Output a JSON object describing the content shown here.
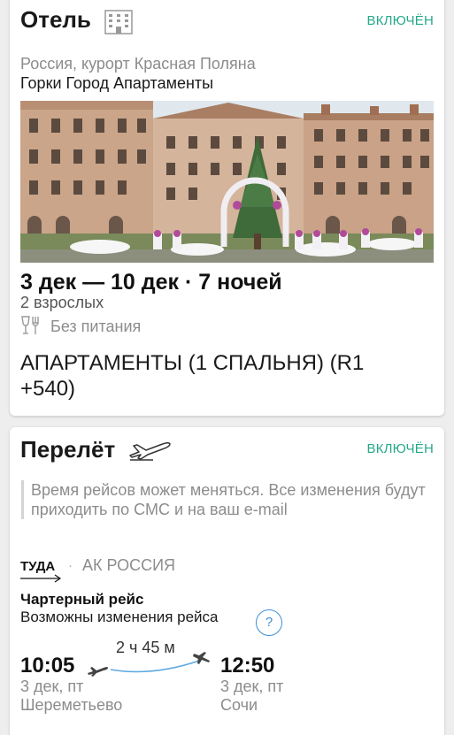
{
  "colors": {
    "accent_green": "#26a98b",
    "link_blue": "#3d8fd6",
    "muted_text": "#8c8c8c"
  },
  "hotel": {
    "title": "Отель",
    "icon": "building-icon",
    "status": "ВКЛЮЧЁН",
    "location": "Россия, курорт Красная Поляна",
    "name": "Горки Город Апартаменты",
    "dates": "3 дек — 10 дек · 7 ночей",
    "guests": "2 взрослых",
    "meal_icon": "glass-fork-icon",
    "meal": "Без питания",
    "room": "АПАРТАМЕНТЫ (1 СПАЛЬНЯ) (R1 +540)"
  },
  "flight": {
    "title": "Перелёт",
    "icon": "airplane-icon",
    "status": "ВКЛЮЧЁН",
    "notice": "Время рейсов может меняться. Все изменения будут приходить по СМС и на ваш e-mail",
    "direction": "ТУДА",
    "separator": "·",
    "airline": "АК РОССИЯ",
    "type": "Чартерный рейс",
    "change_note": "Возможны изменения рейса",
    "help": "?",
    "duration": "2 ч 45 м",
    "departure": {
      "time": "10:05",
      "date": "3 дек, пт",
      "airport": "Шереметьево"
    },
    "arrival": {
      "time": "12:50",
      "date": "3 дек, пт",
      "airport": "Сочи"
    }
  }
}
